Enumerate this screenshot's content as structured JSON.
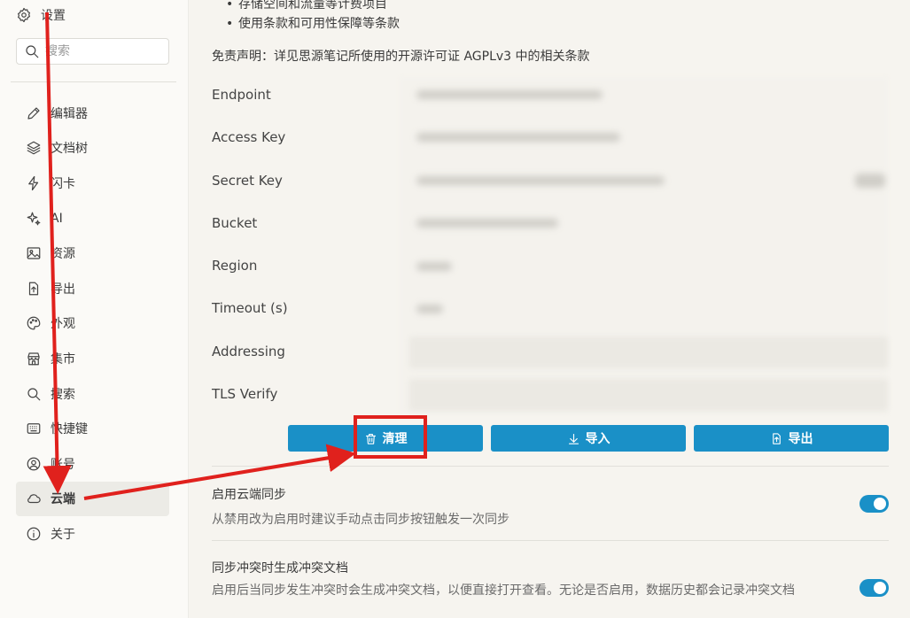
{
  "sidebar": {
    "settings_label": "设置",
    "search_placeholder": "搜索",
    "items": [
      {
        "label": "编辑器",
        "icon": "pencil-icon"
      },
      {
        "label": "文档树",
        "icon": "layers-icon"
      },
      {
        "label": "闪卡",
        "icon": "flash-icon"
      },
      {
        "label": "AI",
        "icon": "sparkle-icon"
      },
      {
        "label": "资源",
        "icon": "image-icon"
      },
      {
        "label": "导出",
        "icon": "export-icon"
      },
      {
        "label": "外观",
        "icon": "palette-icon"
      },
      {
        "label": "集市",
        "icon": "store-icon"
      },
      {
        "label": "搜索",
        "icon": "search-icon"
      },
      {
        "label": "快捷键",
        "icon": "keyboard-icon"
      },
      {
        "label": "账号",
        "icon": "account-icon"
      },
      {
        "label": "云端",
        "icon": "cloud-icon"
      },
      {
        "label": "关于",
        "icon": "info-icon"
      }
    ],
    "active_item": "云端"
  },
  "main": {
    "bullets": [
      "存储空间和流量等计费项目",
      "使用条款和可用性保障等条款"
    ],
    "disclaimer": "免责声明：详见思源笔记所使用的开源许可证 AGPLv3 中的相关条款",
    "fields": [
      {
        "label": "Endpoint"
      },
      {
        "label": "Access Key"
      },
      {
        "label": "Secret Key"
      },
      {
        "label": "Bucket"
      },
      {
        "label": "Region"
      },
      {
        "label": "Timeout (s)"
      },
      {
        "label": "Addressing"
      },
      {
        "label": "TLS Verify"
      }
    ],
    "buttons": {
      "clean": "清理",
      "import": "导入",
      "export": "导出"
    },
    "settings": [
      {
        "title": "启用云端同步",
        "desc": "从禁用改为启用时建议手动点击同步按钮触发一次同步",
        "enabled": true
      },
      {
        "title": "同步冲突时生成冲突文档",
        "desc": "启用后当同步发生冲突时会生成冲突文档，以便直接打开查看。无论是否启用，数据历史都会记录冲突文档",
        "enabled": true
      }
    ]
  },
  "colors": {
    "accent": "#1a90c7",
    "annotation": "#e0211d"
  }
}
